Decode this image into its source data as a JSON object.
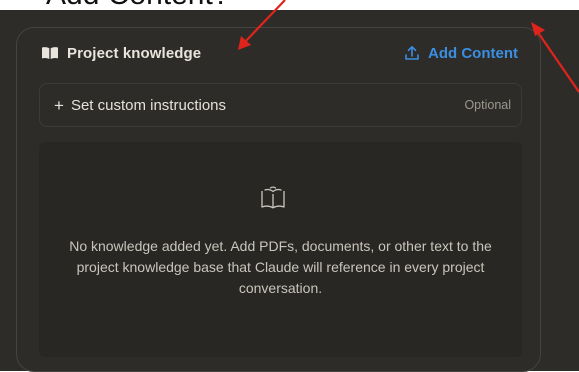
{
  "overlay": {
    "caption": "Add Content?",
    "arrow_color": "#e0241c"
  },
  "card": {
    "title": "Project knowledge",
    "add_content_label": "Add Content",
    "instructions": {
      "label": "Set custom instructions",
      "hint": "Optional"
    },
    "empty_state": {
      "message": "No knowledge added yet. Add PDFs, documents, or other text to the project knowledge base that Claude will reference in every project conversation."
    }
  },
  "colors": {
    "background": "#2d2c29",
    "panel": "#282723",
    "accent": "#3b8fe2",
    "text": "#e9e5dc"
  }
}
